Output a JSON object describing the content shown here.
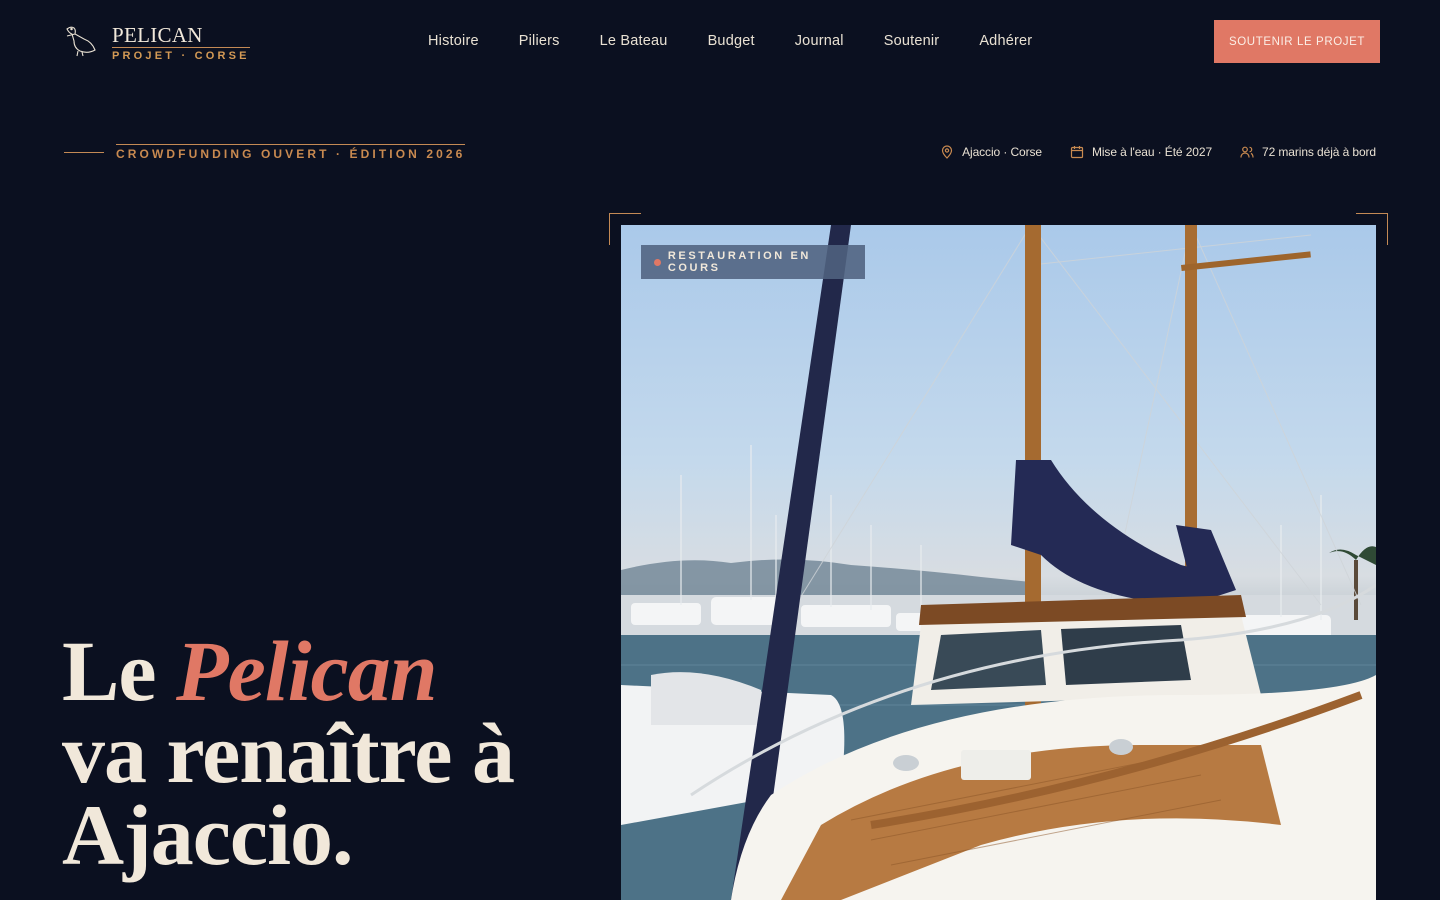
{
  "brand": {
    "name": "PELICAN",
    "tagline": "PROJET · CORSE",
    "logo_icon": "pelican-icon"
  },
  "nav": {
    "items": [
      {
        "label": "Histoire"
      },
      {
        "label": "Piliers"
      },
      {
        "label": "Le Bateau"
      },
      {
        "label": "Budget"
      },
      {
        "label": "Journal"
      },
      {
        "label": "Soutenir"
      },
      {
        "label": "Adhérer"
      }
    ],
    "cta_label": "SOUTENIR LE PROJET"
  },
  "eyebrow": "CROWDFUNDING OUVERT · ÉDITION 2026",
  "meta": {
    "location": {
      "icon": "map-pin-icon",
      "label": "Ajaccio · Corse"
    },
    "launch": {
      "icon": "calendar-icon",
      "label": "Mise à l'eau · Été 2027"
    },
    "sailors": {
      "icon": "users-icon",
      "label": "72 marins déjà à bord"
    }
  },
  "hero": {
    "title_prefix": "Le ",
    "title_accent": "Pelican",
    "title_line2": "va renaître à",
    "title_line3": "Ajaccio."
  },
  "photo": {
    "badge": "RESTAURATION EN COURS"
  },
  "colors": {
    "background": "#0b1020",
    "accent": "#e07865",
    "gold": "#c98a50",
    "text": "#f1e8da"
  }
}
